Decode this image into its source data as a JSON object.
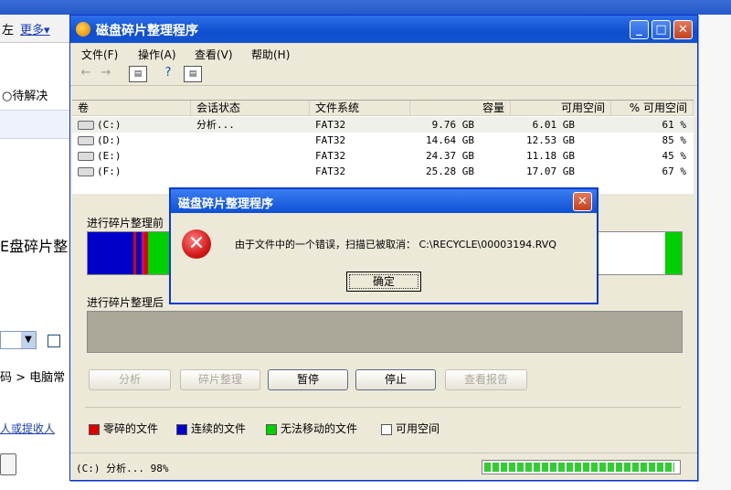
{
  "background_app": {
    "toolbar_item1": "左",
    "toolbar_item2": "更多▾",
    "radio_label": "○待解决",
    "side_text": "E盘碎片整",
    "breadcrumb": "码 > 电脑常",
    "link_text": "人或提收人"
  },
  "window": {
    "title": "磁盘碎片整理程序",
    "minimize": "_",
    "maximize": "□",
    "close": "✕"
  },
  "menu": [
    "文件(F)",
    "操作(A)",
    "查看(V)",
    "帮助(H)"
  ],
  "toolbar_icons": [
    "back-icon",
    "forward-icon",
    "properties-icon",
    "help-icon",
    "console-icon"
  ],
  "volume_table": {
    "columns": [
      "卷",
      "会话状态",
      "文件系统",
      "容量",
      "可用空间",
      "% 可用空间"
    ],
    "rows": [
      {
        "volume": "(C:)",
        "status": "分析...",
        "fs": "FAT32",
        "capacity": "9.76 GB",
        "free": "6.01 GB",
        "pct": "61 %"
      },
      {
        "volume": "(D:)",
        "status": "",
        "fs": "FAT32",
        "capacity": "14.64 GB",
        "free": "12.53 GB",
        "pct": "85 %"
      },
      {
        "volume": "(E:)",
        "status": "",
        "fs": "FAT32",
        "capacity": "24.37 GB",
        "free": "11.18 GB",
        "pct": "45 %"
      },
      {
        "volume": "(F:)",
        "status": "",
        "fs": "FAT32",
        "capacity": "25.28 GB",
        "free": "17.07 GB",
        "pct": "67 %"
      }
    ]
  },
  "panels": {
    "analysis_label": "进行碎片整理前",
    "defrag_label": "进行碎片整理后"
  },
  "buttons": {
    "analyze": "分析",
    "defragment": "碎片整理",
    "pause": "暂停",
    "stop": "停止",
    "view_report": "查看报告"
  },
  "legend": [
    {
      "label": "零碎的文件",
      "color": "#e00000"
    },
    {
      "label": "连续的文件",
      "color": "#0000c8"
    },
    {
      "label": "无法移动的文件",
      "color": "#00d000"
    },
    {
      "label": "可用空间",
      "color": "#ffffff"
    }
  ],
  "status": {
    "text": "(C:) 分析... 98%",
    "progress": 0.98
  },
  "dialog": {
    "title": "磁盘碎片整理程序",
    "message": "由于文件中的一个错误，扫描已被取消： C:\\RECYCLE\\00003194.RVQ",
    "ok": "确定",
    "close": "✕"
  }
}
